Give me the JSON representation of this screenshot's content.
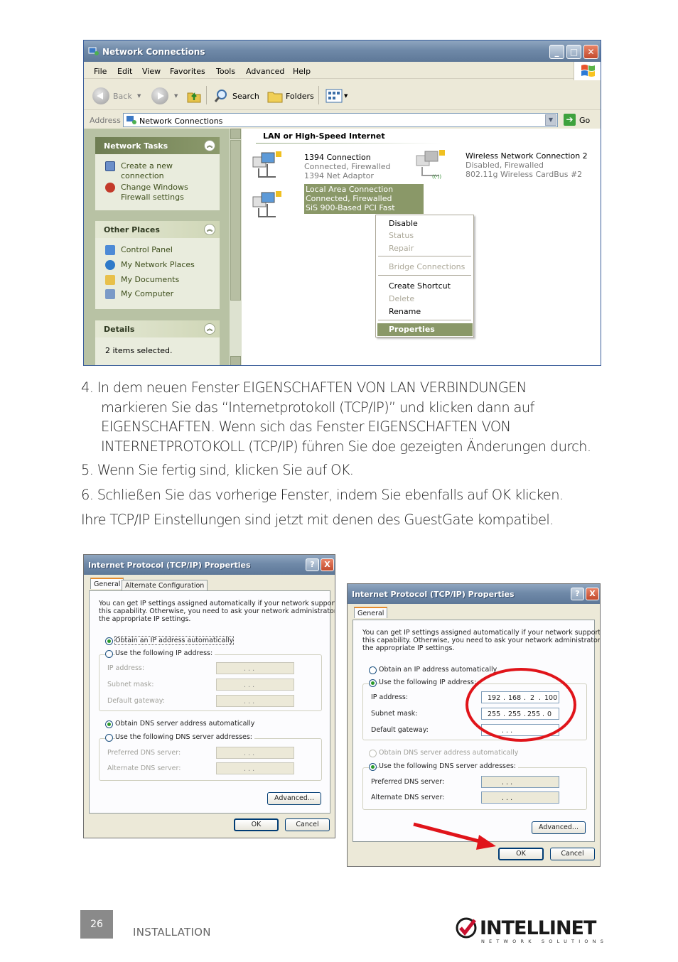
{
  "nc": {
    "title": "Network Connections",
    "menu": [
      "File",
      "Edit",
      "View",
      "Favorites",
      "Tools",
      "Advanced",
      "Help"
    ],
    "toolbar": {
      "back": "Back",
      "search": "Search",
      "folders": "Folders"
    },
    "address_label": "Address",
    "address_value": "Network Connections",
    "go": "Go",
    "panels": {
      "tasks": {
        "title": "Network Tasks",
        "items": [
          "Create a new",
          "connection",
          "Change Windows",
          "Firewall settings"
        ]
      },
      "places": {
        "title": "Other Places",
        "items": [
          "Control Panel",
          "My Network Places",
          "My Documents",
          "My Computer"
        ]
      },
      "details": {
        "title": "Details",
        "text": "2 items selected."
      }
    },
    "section": "LAN or High-Speed Internet",
    "connections": [
      {
        "name": "1394 Connection",
        "status": "Connected, Firewalled",
        "device": "1394 Net Adaptor"
      },
      {
        "name": "Wireless Network Connection 2",
        "status": "Disabled, Firewalled",
        "device": "802.11g Wireless CardBus #2"
      },
      {
        "name": "Local Area Connection",
        "status": "Connected, Firewalled",
        "device": "SiS 900-Based PCI Fast"
      }
    ],
    "context_menu": [
      "Disable",
      "Status",
      "Repair",
      "Bridge Connections",
      "Create Shortcut",
      "Delete",
      "Rename",
      "Properties"
    ]
  },
  "instructions": {
    "step4": [
      "4. In dem neuen Fenster EIGENSCHAFTEN VON LAN VERBINDUNGEN",
      "markieren Sie das “Internetprotokoll (TCP/IP)” und klicken dann auf",
      "EIGENSCHAFTEN. Wenn sich das Fenster  EIGENSCHAFTEN VON",
      "INTERNETPROTOKOLL (TCP/IP) führen Sie doe gezeigten Änderungen durch."
    ],
    "step5": "5. Wenn Sie fertig sind, klicken Sie auf OK.",
    "step6": "6. Schließen Sie das vorherige Fenster, indem Sie ebenfalls auf OK klicken.",
    "final": "Ihre TCP/IP Einstellungen sind jetzt mit denen des GuestGate kompatibel."
  },
  "dialog": {
    "title": "Internet Protocol (TCP/IP) Properties",
    "help": "?",
    "close": "X",
    "tab_general": "General",
    "tab_alternate": "Alternate Configuration",
    "intro": [
      "You can get IP settings assigned automatically if your network supports",
      "this capability. Otherwise, you need to ask your network administrator for",
      "the appropriate IP settings."
    ],
    "obtain_ip": "Obtain an IP address automatically",
    "use_ip": "Use the following IP address:",
    "ip_label": "IP address:",
    "mask_label": "Subnet mask:",
    "gw_label": "Default gateway:",
    "obtain_dns": "Obtain DNS server address automatically",
    "use_dns": "Use the following DNS server addresses:",
    "pref_dns": "Preferred DNS server:",
    "alt_dns": "Alternate DNS server:",
    "advanced": "Advanced...",
    "ok": "OK",
    "cancel": "Cancel",
    "dots": ".      .      .",
    "ip_value": [
      "192",
      "168",
      "2",
      "100"
    ],
    "mask_value": [
      "255",
      "255",
      "255",
      "0"
    ]
  },
  "footer": {
    "page": "26",
    "section": "INSTALLATION",
    "brand": "INTELLINET",
    "tagline": "NETWORK SOLUTIONS"
  },
  "colors": {
    "highlight": "#8a9868",
    "annotation": "#e0141a",
    "titlebar": "#6f89a8"
  }
}
